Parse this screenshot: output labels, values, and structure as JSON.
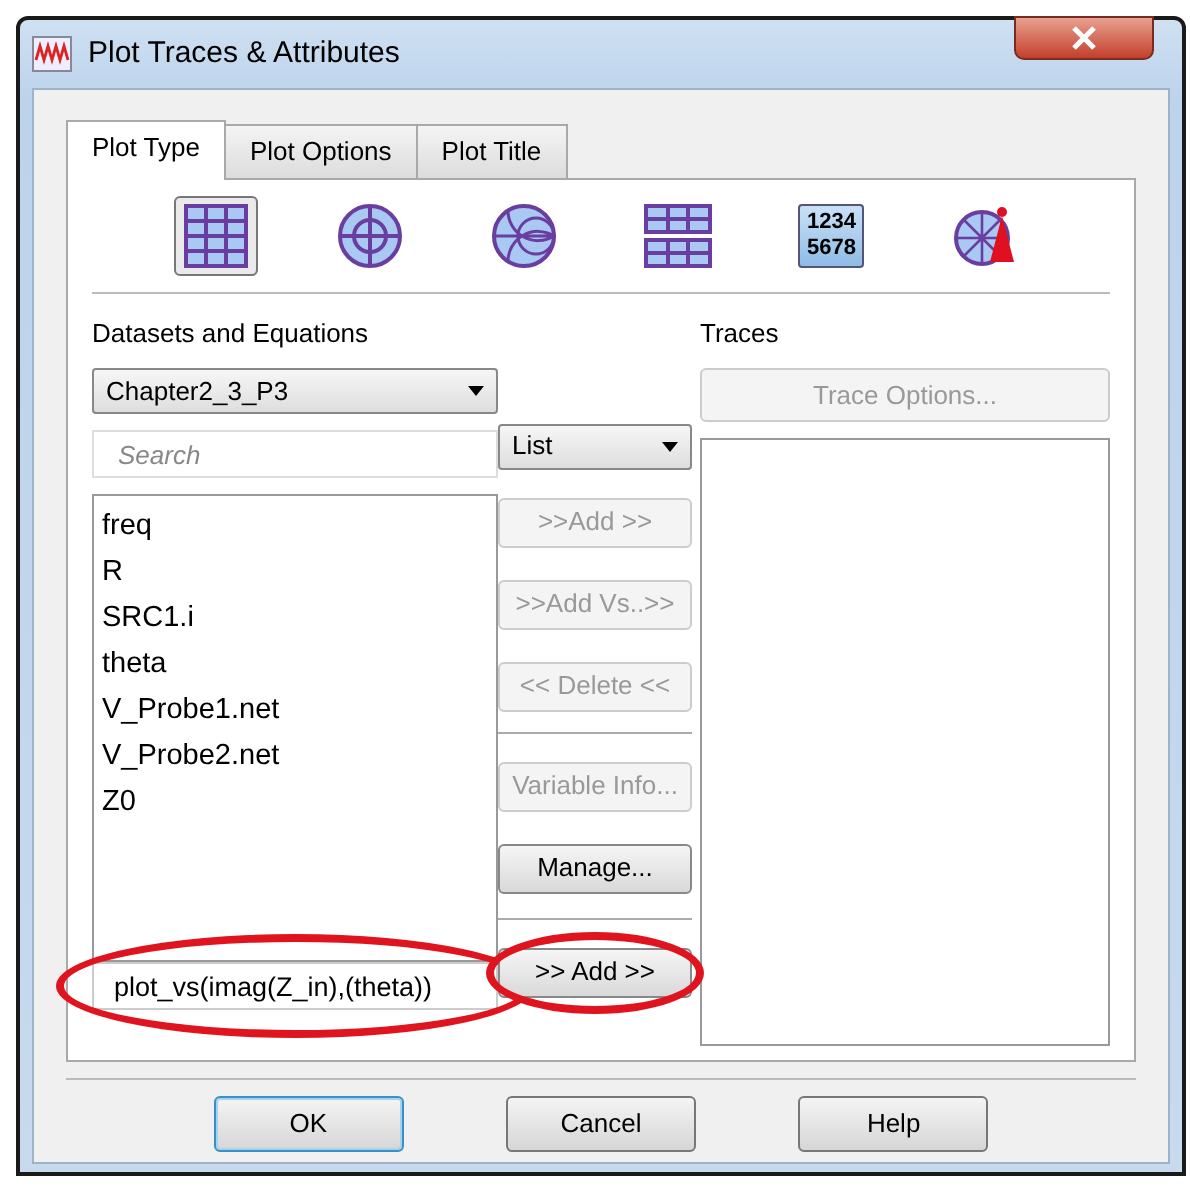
{
  "window": {
    "title": "Plot Traces & Attributes"
  },
  "tabs": [
    {
      "label": "Plot Type",
      "selected": true
    },
    {
      "label": "Plot Options",
      "selected": false
    },
    {
      "label": "Plot Title",
      "selected": false
    }
  ],
  "plot_types": [
    {
      "kind": "rectangular",
      "selected": true
    },
    {
      "kind": "polar",
      "selected": false
    },
    {
      "kind": "smith",
      "selected": false
    },
    {
      "kind": "stacked",
      "selected": false
    },
    {
      "kind": "list",
      "selected": false,
      "lines": [
        "1234",
        "5678"
      ]
    },
    {
      "kind": "antenna",
      "selected": false
    }
  ],
  "datasets": {
    "label": "Datasets and Equations",
    "value": "Chapter2_3_P3",
    "search_placeholder": "Search",
    "view": "List",
    "items": [
      "freq",
      "R",
      "SRC1.i",
      "theta",
      "V_Probe1.net",
      "V_Probe2.net",
      "Z0"
    ],
    "equation": {
      "value": "plot_vs(imag(Z_in),(theta))",
      "circled": true
    }
  },
  "middle_buttons": [
    {
      "label": ">>Add >>",
      "disabled": true,
      "circled": false
    },
    {
      "label": ">>Add Vs..>>",
      "disabled": true,
      "circled": false
    },
    {
      "label": "<< Delete <<",
      "disabled": true,
      "circled": false
    },
    {
      "kind": "divider"
    },
    {
      "label": "Variable Info...",
      "disabled": true,
      "circled": false
    },
    {
      "label": "Manage...",
      "disabled": false,
      "circled": false
    },
    {
      "kind": "divider"
    },
    {
      "label": ">> Add >>",
      "disabled": false,
      "circled": true
    }
  ],
  "traces": {
    "label": "Traces",
    "button": {
      "label": "Trace Options...",
      "disabled": true
    }
  },
  "buttons": [
    {
      "label": "OK",
      "default": true
    },
    {
      "label": "Cancel",
      "default": false
    },
    {
      "label": "Help",
      "default": false
    }
  ]
}
